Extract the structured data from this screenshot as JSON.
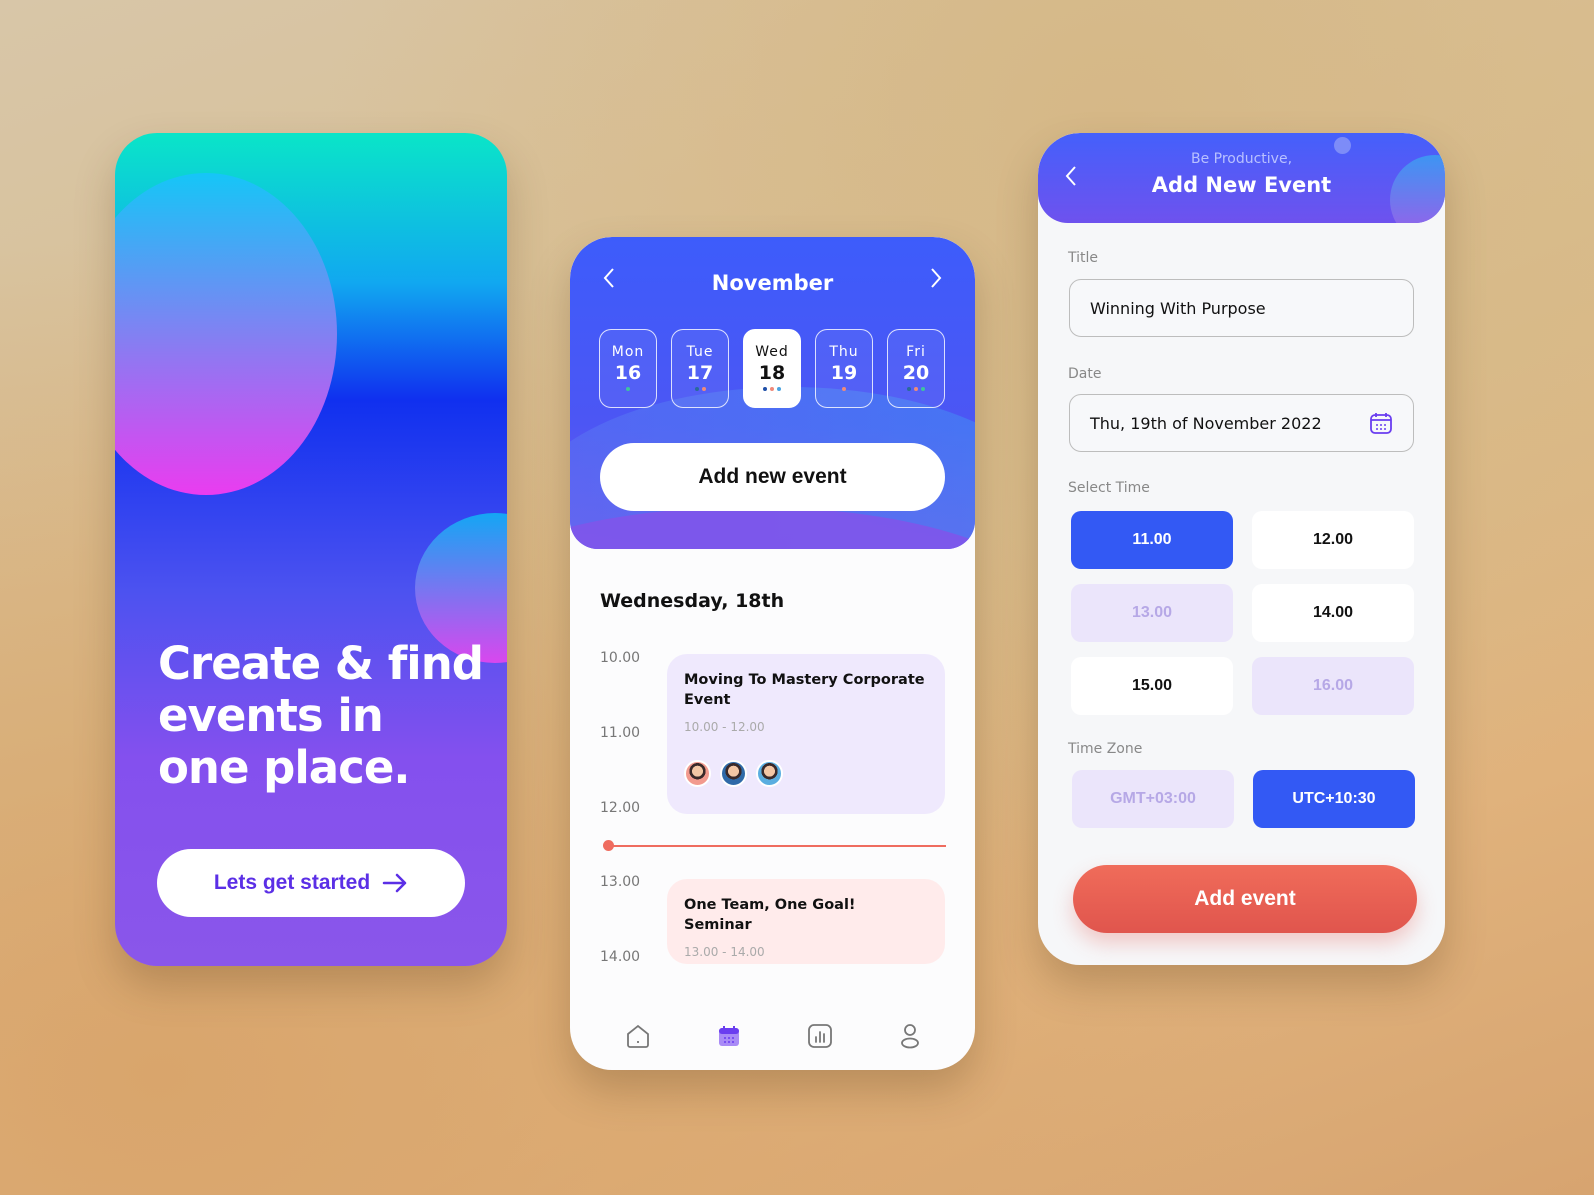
{
  "onboarding": {
    "headline_lines": [
      "Create & find",
      "events in",
      "one place."
    ],
    "cta_label": "Lets get started",
    "cta_icon": "arrow-right-icon"
  },
  "calendar": {
    "month": "November",
    "prev_icon": "chevron-left-icon",
    "next_icon": "chevron-right-icon",
    "days": [
      {
        "name": "Mon",
        "num": "16",
        "dots": [
          "#3ec49e"
        ],
        "selected": false
      },
      {
        "name": "Tue",
        "num": "17",
        "dots": [
          "#2a6a9a",
          "#f08a7a"
        ],
        "selected": false
      },
      {
        "name": "Wed",
        "num": "18",
        "dots": [
          "#1f4fa8",
          "#f08a7a",
          "#4aa3e0"
        ],
        "selected": true
      },
      {
        "name": "Thu",
        "num": "19",
        "dots": [
          "#f08a7a"
        ],
        "selected": false
      },
      {
        "name": "Fri",
        "num": "20",
        "dots": [
          "#2a6a9a",
          "#f08a7a",
          "#3ec49e"
        ],
        "selected": false
      }
    ],
    "add_button": "Add new event",
    "day_title": "Wednesday, 18th",
    "hours": [
      "10.00",
      "11.00",
      "12.00",
      "13.00",
      "14.00"
    ],
    "events": [
      {
        "title": "Moving To Mastery Corporate Event",
        "time": "10.00 - 12.00",
        "color": "#efe9fd",
        "attendees": [
          "#f29a8e",
          "#2f6aa8",
          "#5aaee0"
        ]
      },
      {
        "title": "One Team, One Goal! Seminar",
        "time": "13.00 - 14.00",
        "color": "#ffebeb"
      }
    ],
    "now_color": "#ef6c5f",
    "tabbar": [
      {
        "icon": "home-icon",
        "active": false
      },
      {
        "icon": "calendar-icon",
        "active": true
      },
      {
        "icon": "stats-icon",
        "active": false
      },
      {
        "icon": "profile-icon",
        "active": false
      }
    ]
  },
  "add_event": {
    "subtitle": "Be Productive,",
    "title": "Add New Event",
    "back_icon": "chevron-left-icon",
    "title_label": "Title",
    "title_value": "Winning With Purpose",
    "date_label": "Date",
    "date_value": "Thu, 19th of November 2022",
    "time_label": "Select Time",
    "times": [
      {
        "t": "11.00",
        "state": "selected"
      },
      {
        "t": "12.00",
        "state": "available"
      },
      {
        "t": "13.00",
        "state": "disabled"
      },
      {
        "t": "14.00",
        "state": "available"
      },
      {
        "t": "15.00",
        "state": "available"
      },
      {
        "t": "16.00",
        "state": "disabled"
      }
    ],
    "tz_label": "Time Zone",
    "zones": [
      {
        "t": "GMT+03:00",
        "state": "disabled"
      },
      {
        "t": "UTC+10:30",
        "state": "selected"
      }
    ],
    "submit": "Add event",
    "accent": "#3359f4",
    "submit_color": "#e65e52"
  }
}
